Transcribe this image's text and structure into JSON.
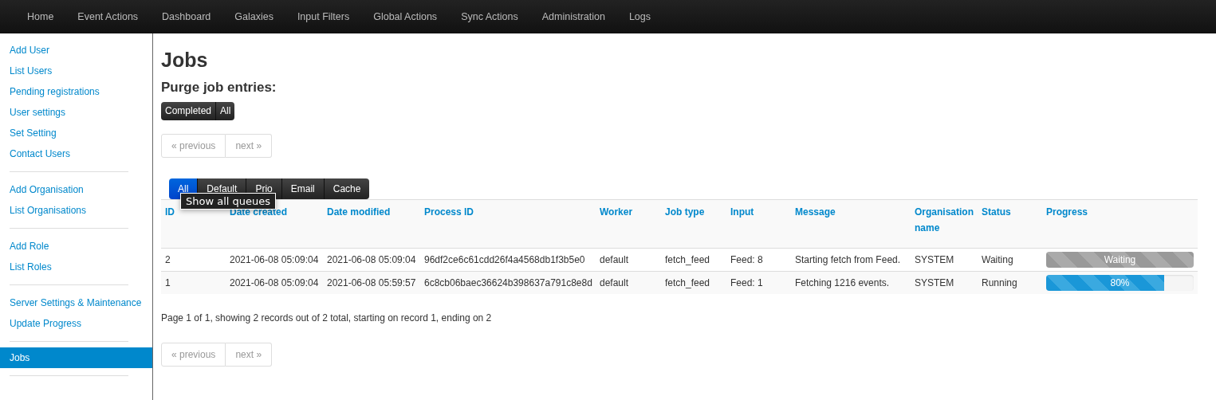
{
  "navbar": {
    "items": [
      "Home",
      "Event Actions",
      "Dashboard",
      "Galaxies",
      "Input Filters",
      "Global Actions",
      "Sync Actions",
      "Administration",
      "Logs"
    ]
  },
  "sidebar": {
    "groups": [
      {
        "items": [
          {
            "label": "Add User",
            "selected": false
          },
          {
            "label": "List Users",
            "selected": false
          },
          {
            "label": "Pending registrations",
            "selected": false
          },
          {
            "label": "User settings",
            "selected": false
          },
          {
            "label": "Set Setting",
            "selected": false
          },
          {
            "label": "Contact Users",
            "selected": false
          }
        ]
      },
      {
        "items": [
          {
            "label": "Add Organisation",
            "selected": false
          },
          {
            "label": "List Organisations",
            "selected": false
          }
        ]
      },
      {
        "items": [
          {
            "label": "Add Role",
            "selected": false
          },
          {
            "label": "List Roles",
            "selected": false
          }
        ]
      },
      {
        "items": [
          {
            "label": "Server Settings & Maintenance",
            "selected": false
          },
          {
            "label": "Update Progress",
            "selected": false
          }
        ]
      },
      {
        "items": [
          {
            "label": "Jobs",
            "selected": true
          }
        ]
      }
    ]
  },
  "page": {
    "title": "Jobs",
    "purge_heading": "Purge job entries:",
    "purge_buttons": [
      "Completed",
      "All"
    ],
    "pagination_top": {
      "previous": "« previous",
      "next": "next »"
    },
    "queue_tabs": [
      {
        "label": "All",
        "selected": true
      },
      {
        "label": "Default",
        "selected": false
      },
      {
        "label": "Prio",
        "selected": false
      },
      {
        "label": "Email",
        "selected": false
      },
      {
        "label": "Cache",
        "selected": false
      }
    ],
    "tooltip": "Show all queues",
    "table": {
      "columns": [
        "ID",
        "Date created",
        "Date modified",
        "Process ID",
        "Worker",
        "Job type",
        "Input",
        "Message",
        "Organisation name",
        "Status",
        "Progress"
      ],
      "rows": [
        {
          "cells": [
            "2",
            "2021-06-08 05:09:04",
            "2021-06-08 05:09:04",
            "96df2ce6c61cdd26f4a4568db1f3b5e0",
            "default",
            "fetch_feed",
            "Feed: 8",
            "Starting fetch from Feed.",
            "SYSTEM",
            "Waiting"
          ],
          "progress": {
            "kind": "waiting",
            "level": 1,
            "label": "Waiting"
          }
        },
        {
          "cells": [
            "1",
            "2021-06-08 05:09:04",
            "2021-06-08 05:59:57",
            "6c8cb06baec36624b398637a791c8e8d",
            "default",
            "fetch_feed",
            "Feed: 1",
            "Fetching 1216 events.",
            "SYSTEM",
            "Running"
          ],
          "progress": {
            "kind": "running",
            "level": 0.8,
            "label": "80%"
          }
        }
      ]
    },
    "summary": "Page 1 of 1, showing 2 records out of 2 total, starting on record 1, ending on 2",
    "pagination_bottom": {
      "previous": "« previous",
      "next": "next »"
    }
  }
}
